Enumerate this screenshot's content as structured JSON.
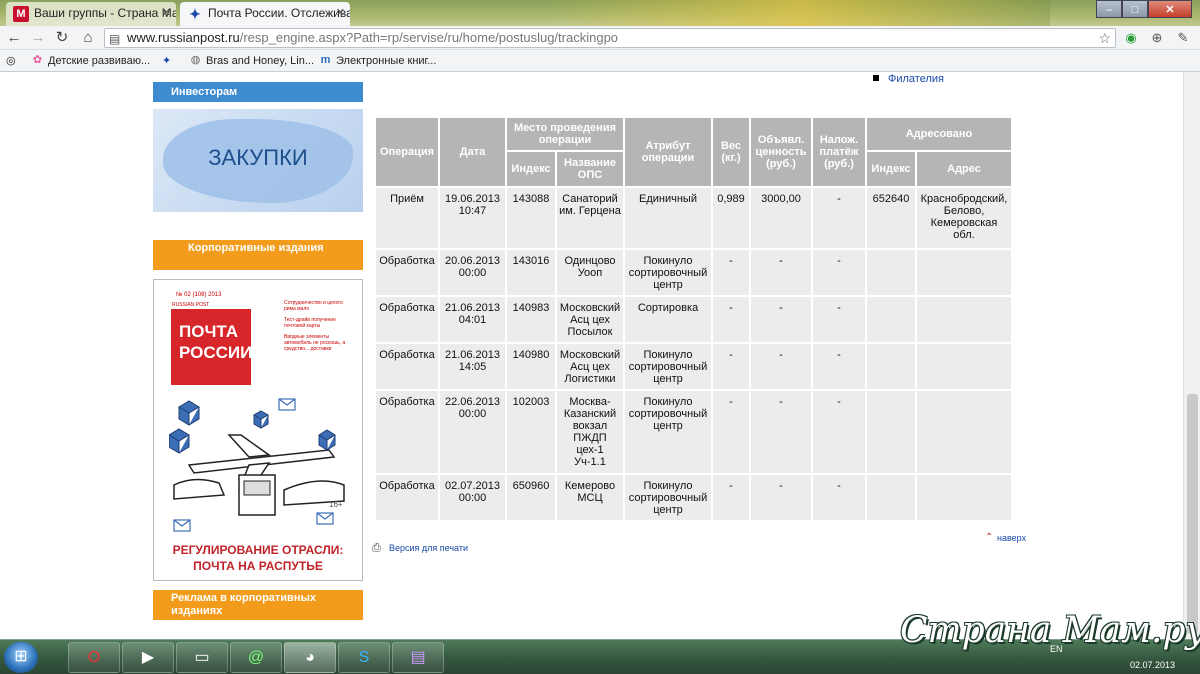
{
  "browser": {
    "tabs": [
      {
        "title": "Ваши группы - Страна Ма",
        "favicon": "M"
      },
      {
        "title": "Почта России. Отслежива",
        "favicon": "eagle"
      }
    ],
    "url_host": "www.russianpost.ru",
    "url_path": "/resp_engine.aspx?Path=rp/servise/ru/home/postuslug/trackingpo",
    "bookmarks": [
      {
        "label": "Детские развиваю..."
      },
      {
        "label": "Bras and Honey, Lin..."
      },
      {
        "label": "Электронные книг..."
      }
    ]
  },
  "sidebar": {
    "investors": "Инвесторам",
    "zakupki": "ЗАКУПКИ",
    "corporate": "Корпоративные издания",
    "magazine": {
      "issue": "№ 02 (108) 2013",
      "brand_small": "RUSSIAN POST",
      "logo_line1": "ПОЧТА",
      "logo_line2": "РОССИИ",
      "blurb1": "Сотрудничество и целого рима мало",
      "blurb2": "Тест-драйв получение почтовой карты",
      "blurb3": "Вводные элементы автомобиль не роскошь, а средство... доставки",
      "age": "16+",
      "headline1": "РЕГУЛИРОВАНИЕ ОТРАСЛИ:",
      "headline2": "ПОЧТА НА РАСПУТЬЕ"
    },
    "ads": "Реклама в корпоративных изданиях"
  },
  "right_menu": {
    "filatelia": "Филателия"
  },
  "table": {
    "h_operation": "Операция",
    "h_date": "Дата",
    "h_place": "Место проведения операции",
    "h_index": "Индекс",
    "h_ops_name": "Название ОПС",
    "h_attribute": "Атрибут операции",
    "h_weight": "Вес (кг.)",
    "h_declared": "Объявл. ценность (руб.)",
    "h_cod": "Налож. платёж (руб.)",
    "h_addressed": "Адресовано",
    "h_addr_index": "Индекс",
    "h_address": "Адрес",
    "rows": [
      {
        "op": "Приём",
        "date": "19.06.2013",
        "time": "10:47",
        "index": "143088",
        "ops": "Санаторий им. Герцена",
        "attr": "Единичный",
        "weight": "0,989",
        "declared": "3000,00",
        "cod": "-",
        "to_index": "652640",
        "to_addr": "Краснобродский, Белово, Кемеровская обл."
      },
      {
        "op": "Обработка",
        "date": "20.06.2013",
        "time": "00:00",
        "index": "143016",
        "ops": "Одинцово Уооп",
        "attr": "Покинуло сортировочный центр",
        "weight": "-",
        "declared": "-",
        "cod": "-",
        "to_index": "",
        "to_addr": ""
      },
      {
        "op": "Обработка",
        "date": "21.06.2013",
        "time": "04:01",
        "index": "140983",
        "ops": "Московский Асц цех Посылок",
        "attr": "Сортировка",
        "weight": "-",
        "declared": "-",
        "cod": "-",
        "to_index": "",
        "to_addr": ""
      },
      {
        "op": "Обработка",
        "date": "21.06.2013",
        "time": "14:05",
        "index": "140980",
        "ops": "Московский Асц цех Логистики",
        "attr": "Покинуло сортировочный центр",
        "weight": "-",
        "declared": "-",
        "cod": "-",
        "to_index": "",
        "to_addr": ""
      },
      {
        "op": "Обработка",
        "date": "22.06.2013",
        "time": "00:00",
        "index": "102003",
        "ops": "Москва-Казанский вокзал ПЖДП цех-1 Уч-1.1",
        "attr": "Покинуло сортировочный центр",
        "weight": "-",
        "declared": "-",
        "cod": "-",
        "to_index": "",
        "to_addr": ""
      },
      {
        "op": "Обработка",
        "date": "02.07.2013",
        "time": "00:00",
        "index": "650960",
        "ops": "Кемерово МСЦ",
        "attr": "Покинуло сортировочный центр",
        "weight": "-",
        "declared": "-",
        "cod": "-",
        "to_index": "",
        "to_addr": ""
      }
    ]
  },
  "links": {
    "print": "Версия для печати",
    "top": "наверх"
  },
  "taskbar": {
    "lang": "EN",
    "date": "02.07.2013"
  },
  "watermark": "Страна Мам.ру",
  "colors": {
    "accent_blue": "#3f8bd0",
    "accent_orange": "#f39c1b",
    "header_gray": "#b5b5b5",
    "cell_gray": "#ececec"
  }
}
